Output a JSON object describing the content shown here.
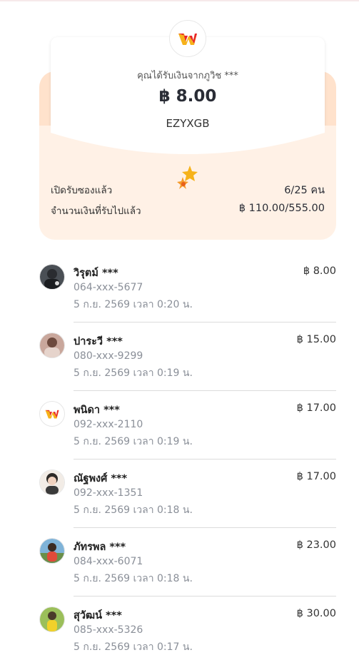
{
  "header": {
    "sender_line": "คุณได้รับเงินจากภูวิช ***",
    "amount": "฿ 8.00",
    "code": "EZYXGB"
  },
  "stats": {
    "opened_label": "เปิดรับซองแล้ว",
    "opened_value": "6/25 คน",
    "received_label": "จำนวนเงินที่รับไปแล้ว",
    "received_value": "฿ 110.00/555.00"
  },
  "recipients": [
    {
      "name": "วิรุตม์ ***",
      "phone": "064-xxx-5677",
      "time": "5 ก.ย. 2569 เวลา 0:20 น.",
      "amount": "฿ 8.00",
      "avatar": "photo-person-dark"
    },
    {
      "name": "ปาระวี ***",
      "phone": "080-xxx-9299",
      "time": "5 ก.ย. 2569 เวลา 0:19 น.",
      "amount": "฿ 15.00",
      "avatar": "photo-person-light"
    },
    {
      "name": "พนิดา ***",
      "phone": "092-xxx-2110",
      "time": "5 ก.ย. 2569 เวลา 0:19 น.",
      "amount": "฿ 17.00",
      "avatar": "wallet-logo"
    },
    {
      "name": "ณัฐพงศ์ ***",
      "phone": "092-xxx-1351",
      "time": "5 ก.ย. 2569 เวลา 0:18 น.",
      "amount": "฿ 17.00",
      "avatar": "photo-child"
    },
    {
      "name": "ภัทรพล ***",
      "phone": "084-xxx-6071",
      "time": "5 ก.ย. 2569 เวลา 0:18 น.",
      "amount": "฿ 23.00",
      "avatar": "photo-outdoor"
    },
    {
      "name": "สุวัฒน์ ***",
      "phone": "085-xxx-5326",
      "time": "5 ก.ย. 2569 เวลา 0:17 น.",
      "amount": "฿ 30.00",
      "avatar": "photo-yellow"
    }
  ],
  "colors": {
    "envelope_bg": "#fff1e6",
    "logo_red": "#e8252c",
    "logo_yellow": "#f6b21a"
  }
}
